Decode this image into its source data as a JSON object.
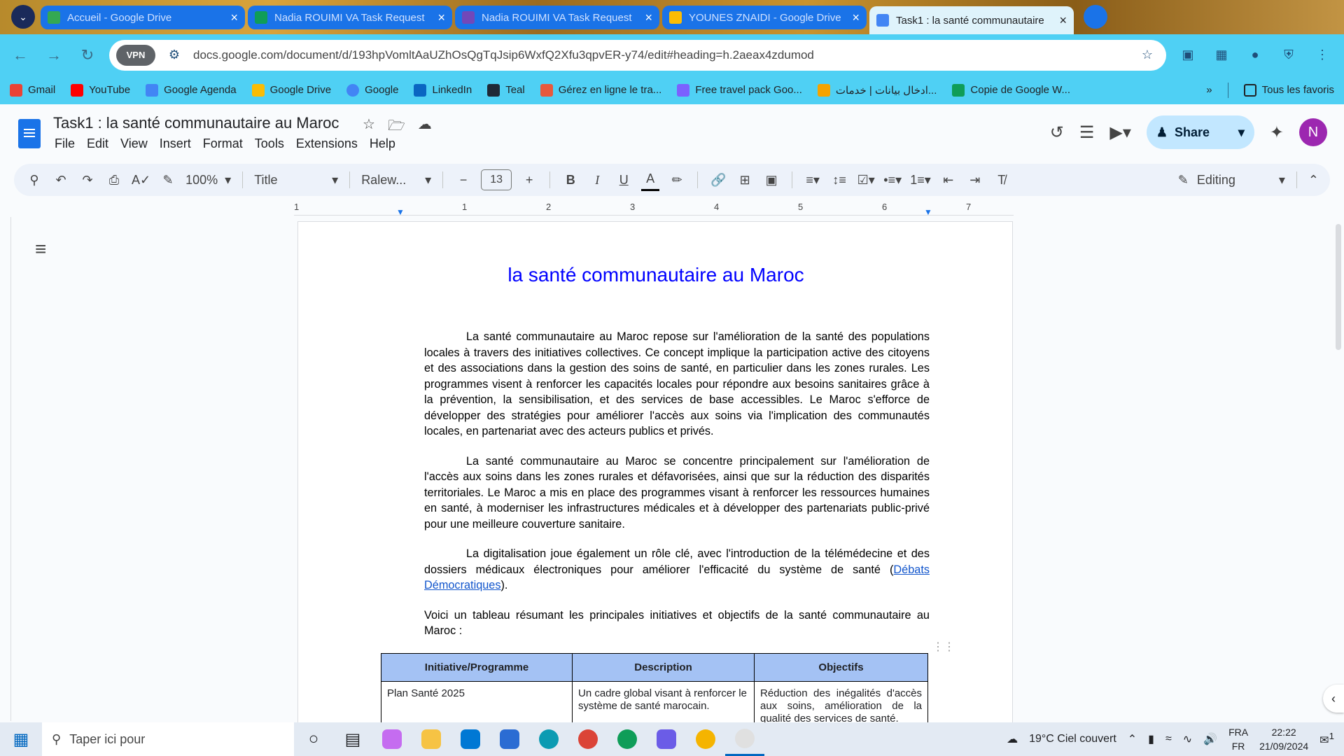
{
  "browser": {
    "tabs": [
      {
        "title": "Accueil - Google Drive",
        "color": "#34a853"
      },
      {
        "title": "Nadia ROUIMI VA Task Request",
        "color": "#0f9d58"
      },
      {
        "title": "Nadia ROUIMI VA Task Request",
        "color": "#7248b9"
      },
      {
        "title": "YOUNES ZNAIDI - Google Drive",
        "color": "#fbbc04"
      },
      {
        "title": "Task1 : la santé communautaire",
        "color": "#4285f4"
      }
    ],
    "vpn_label": "VPN",
    "url": "docs.google.com/document/d/193hpVomltAaUZhOsQgTqJsip6WxfQ2Xfu3qpvER-y74/edit#heading=h.2aeax4zdumod",
    "bookmarks": [
      "Gmail",
      "YouTube",
      "Google Agenda",
      "Google Drive",
      "Google",
      "LinkedIn",
      "Teal",
      "Gérez en ligne le tra...",
      "Free travel pack Goo...",
      "ادخال بيانات | خدمات...",
      "Copie de Google W..."
    ],
    "all_bookmarks": "Tous les favoris"
  },
  "doc": {
    "title": "Task1 : la santé communautaire au Maroc",
    "menus": [
      "File",
      "Edit",
      "View",
      "Insert",
      "Format",
      "Tools",
      "Extensions",
      "Help"
    ],
    "share_label": "Share",
    "avatar_letter": "N",
    "zoom": "100%",
    "style": "Title",
    "font": "Ralew...",
    "font_size": "13",
    "mode": "Editing",
    "ruler_numbers": [
      "1",
      "1",
      "2",
      "3",
      "4",
      "5",
      "6",
      "7"
    ],
    "heading": "la santé communautaire au Maroc",
    "para1": "La santé communautaire au Maroc repose sur l'amélioration de la santé des populations locales à travers des initiatives collectives. Ce concept implique la participation active des citoyens et des associations dans la gestion des soins de santé, en particulier dans les zones rurales. Les programmes visent à renforcer les capacités locales pour répondre aux besoins sanitaires grâce à la prévention, la sensibilisation, et des services de base accessibles. Le Maroc s'efforce de développer des stratégies pour améliorer l'accès aux soins via l'implication des communautés locales, en partenariat avec des acteurs publics et privés.",
    "para2": "La santé communautaire au Maroc se concentre principalement sur l'amélioration de l'accès aux soins dans les zones rurales et défavorisées, ainsi que sur la réduction des disparités territoriales. Le Maroc a mis en place des programmes visant à renforcer les ressources humaines en santé, à moderniser les infrastructures médicales et à développer des partenariats public-privé pour une meilleure couverture sanitaire.",
    "para3_text": "La digitalisation joue également un rôle clé, avec l'introduction de la télémédecine et des dossiers médicaux électroniques pour améliorer l'efficacité du système de santé (",
    "para3_link": "Débats Démocratiques",
    "para3_end": ").",
    "para4": "Voici un tableau résumant les principales initiatives et objectifs de la santé communautaire au Maroc :",
    "table": {
      "headers": [
        "Initiative/Programme",
        "Description",
        "Objectifs"
      ],
      "row1": [
        "Plan Santé 2025",
        "Un cadre global visant à renforcer le système de santé marocain.",
        "Réduction des inégalités d'accès aux soins, amélioration de la qualité des services de santé."
      ]
    }
  },
  "taskbar": {
    "search_placeholder": "Taper ici pour",
    "weather": "19°C  Ciel couvert",
    "lang_top": "FRA",
    "lang_bottom": "FR",
    "time": "22:22",
    "date": "21/09/2024",
    "notif_count": "1"
  }
}
